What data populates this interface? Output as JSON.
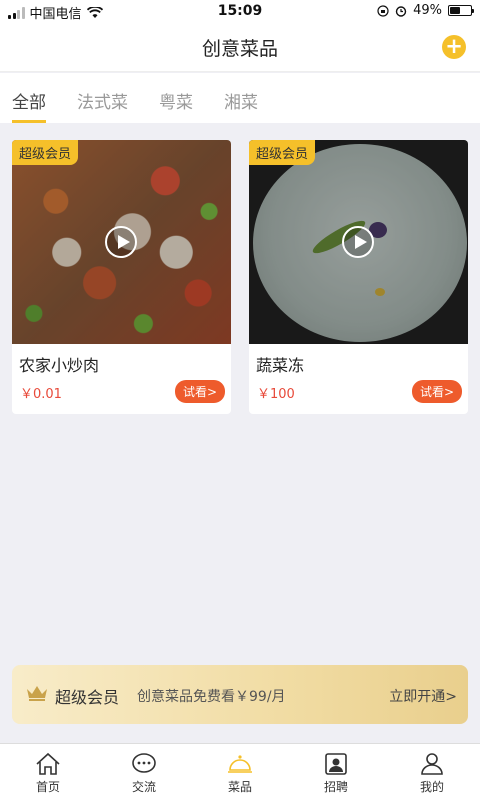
{
  "status_bar": {
    "carrier": "中国电信",
    "time": "15:09",
    "battery": "49%"
  },
  "header": {
    "title": "创意菜品",
    "add_icon": "plus-circle-icon",
    "accent_color": "#f5c02a"
  },
  "tabs": [
    {
      "label": "全部",
      "active": true
    },
    {
      "label": "法式菜",
      "active": false
    },
    {
      "label": "粤菜",
      "active": false
    },
    {
      "label": "湘菜",
      "active": false
    }
  ],
  "cards": [
    {
      "badge": "超级会员",
      "title": "农家小炒肉",
      "price": "￥0.01",
      "try_label": "试看>"
    },
    {
      "badge": "超级会员",
      "title": "蔬菜冻",
      "price": "￥100",
      "try_label": "试看>"
    }
  ],
  "vip_banner": {
    "title": "超级会员",
    "desc": "创意菜品免费看￥99/月",
    "action": "立即开通>"
  },
  "tabbar": [
    {
      "label": "首页",
      "icon": "home-icon",
      "active": false
    },
    {
      "label": "交流",
      "icon": "chat-icon",
      "active": false
    },
    {
      "label": "菜品",
      "icon": "dish-cover-icon",
      "active": true
    },
    {
      "label": "招聘",
      "icon": "recruit-icon",
      "active": false
    },
    {
      "label": "我的",
      "icon": "person-icon",
      "active": false
    }
  ]
}
